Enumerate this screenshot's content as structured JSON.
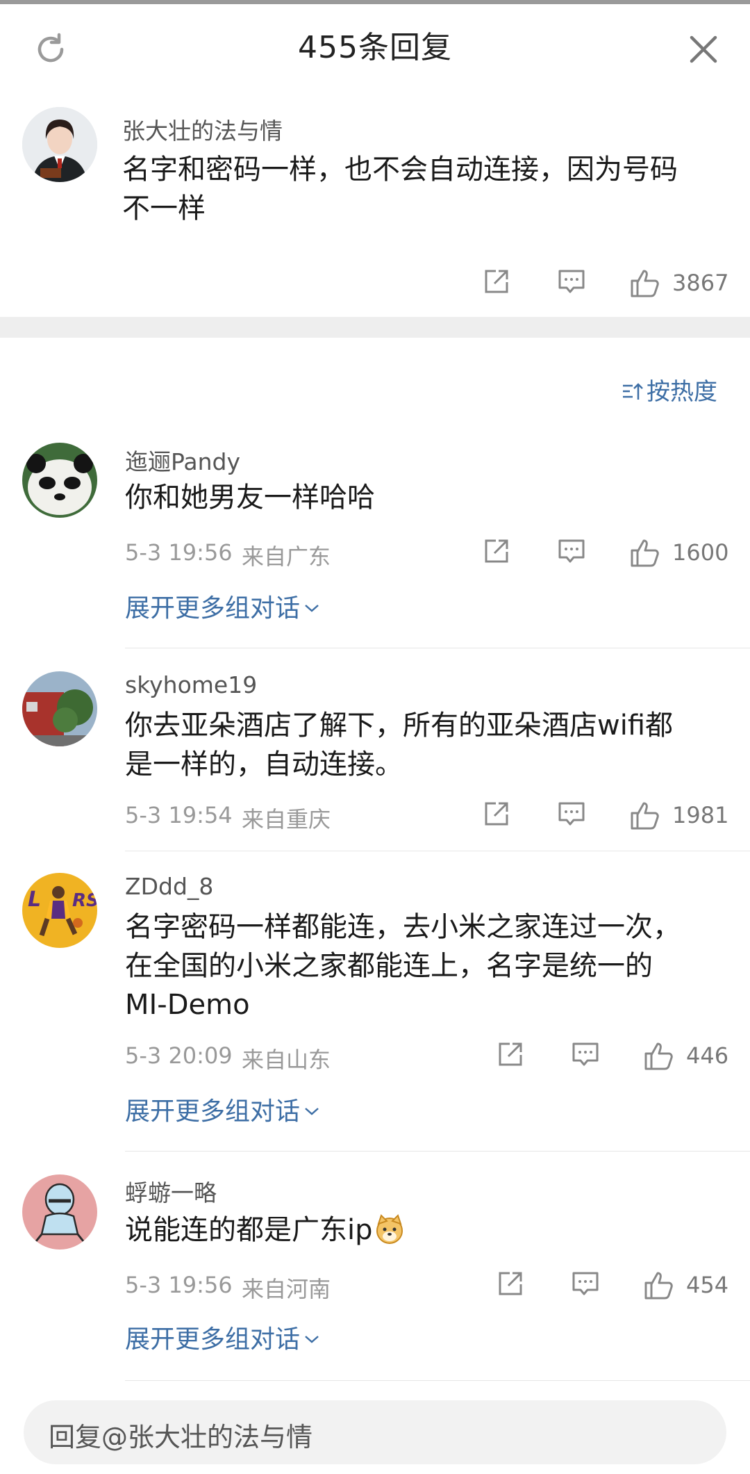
{
  "header": {
    "title": "455条回复"
  },
  "root_comment": {
    "author": "张大壮的法与情",
    "text_line1": "名字和密码一样，也不会自动连接，因为号码",
    "text_line2": "不一样",
    "likes": "3867"
  },
  "sort": {
    "label": "按热度"
  },
  "replies": [
    {
      "author": "迤逦Pandy",
      "line1": "你和她男友一样哈哈",
      "line2": "",
      "line3": "",
      "time": "5-3 19:56",
      "location": "来自广东",
      "likes": "1600",
      "expand": "展开更多组对话"
    },
    {
      "author": "skyhome19",
      "line1": "你去亚朵酒店了解下，所有的亚朵酒店wifi都",
      "line2": "是一样的，自动连接。",
      "line3": "",
      "time": "5-3 19:54",
      "location": "来自重庆",
      "likes": "1981",
      "expand": ""
    },
    {
      "author": "ZDdd_8",
      "line1": "名字密码一样都能连，去小米之家连过一次，",
      "line2": "在全国的小米之家都能连上，名字是统一的",
      "line3": "MI-Demo",
      "time": "5-3 20:09",
      "location": "来自山东",
      "likes": "446",
      "expand": "展开更多组对话"
    },
    {
      "author": "蜉蝣一略",
      "line1": "说能连的都是广东ip",
      "line2": "",
      "line3": "",
      "time": "5-3 19:56",
      "location": "来自河南",
      "likes": "454",
      "expand": "展开更多组对话"
    }
  ],
  "reply_input": {
    "placeholder": "回复@张大壮的法与情"
  },
  "colors": {
    "link_blue": "#3d6ea5",
    "meta_gray": "#999999",
    "band_gray": "#eeeeee"
  }
}
